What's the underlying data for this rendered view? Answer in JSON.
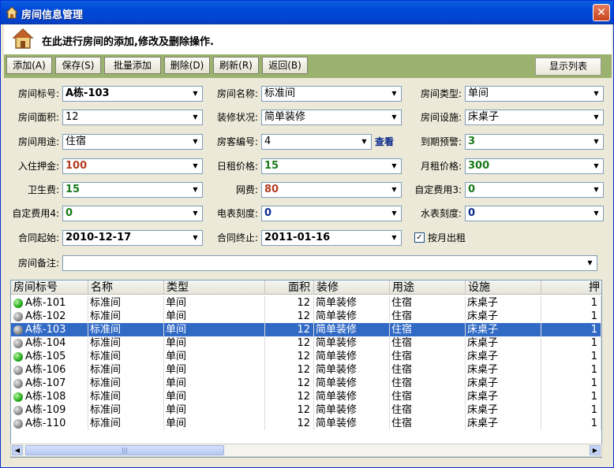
{
  "window": {
    "title": "房间信息管理",
    "close_label": "✕"
  },
  "header": {
    "text": "在此进行房间的添加,修改及删除操作."
  },
  "toolbar": {
    "buttons": [
      "添加(A)",
      "保存(S)",
      "批量添加",
      "删除(D)",
      "刷新(R)",
      "返回(B)"
    ],
    "show_list": "显示列表"
  },
  "form": {
    "room_no_label": "房间标号:",
    "room_no": "A栋-103",
    "room_name_label": "房间名称:",
    "room_name": "标准间",
    "room_type_label": "房间类型:",
    "room_type": "单间",
    "area_label": "房间面积:",
    "area": "12",
    "decor_label": "装修状况:",
    "decor": "简单装修",
    "facility_label": "房间设施:",
    "facility": "床桌子",
    "usage_label": "房间用途:",
    "usage": "住宿",
    "tenant_label": "房客编号:",
    "tenant": "4",
    "view_link": "查看",
    "expire_label": "到期预警:",
    "expire": "3",
    "deposit_label": "入住押金:",
    "deposit": "100",
    "daily_label": "日租价格:",
    "daily": "15",
    "monthly_label": "月租价格:",
    "monthly": "300",
    "sanitation_label": "卫生费:",
    "sanitation": "15",
    "network_label": "网费:",
    "network": "80",
    "custom3_label": "自定费用3:",
    "custom3": "0",
    "custom4_label": "自定费用4:",
    "custom4": "0",
    "elec_label": "电表刻度:",
    "elec": "0",
    "water_label": "水表刻度:",
    "water": "0",
    "start_label": "合同起始:",
    "start": "2010-12-17",
    "end_label": "合同终止:",
    "end": "2011-01-16",
    "monthly_rent_check": "按月出租",
    "note_label": "房间备注:",
    "note": ""
  },
  "grid": {
    "columns": [
      "房间标号",
      "名称",
      "类型",
      "面积",
      "装修",
      "用途",
      "设施",
      "押"
    ],
    "rows": [
      {
        "status": "green",
        "no": "A栋-101",
        "name": "标准间",
        "type": "单间",
        "area": "12",
        "decor": "简单装修",
        "usage": "住宿",
        "facility": "床桌子",
        "extra": "1"
      },
      {
        "status": "gray",
        "no": "A栋-102",
        "name": "标准间",
        "type": "单间",
        "area": "12",
        "decor": "简单装修",
        "usage": "住宿",
        "facility": "床桌子",
        "extra": "1"
      },
      {
        "status": "gray",
        "no": "A栋-103",
        "name": "标准间",
        "type": "单间",
        "area": "12",
        "decor": "简单装修",
        "usage": "住宿",
        "facility": "床桌子",
        "extra": "1"
      },
      {
        "status": "gray",
        "no": "A栋-104",
        "name": "标准间",
        "type": "单间",
        "area": "12",
        "decor": "简单装修",
        "usage": "住宿",
        "facility": "床桌子",
        "extra": "1"
      },
      {
        "status": "green",
        "no": "A栋-105",
        "name": "标准间",
        "type": "单间",
        "area": "12",
        "decor": "简单装修",
        "usage": "住宿",
        "facility": "床桌子",
        "extra": "1"
      },
      {
        "status": "gray",
        "no": "A栋-106",
        "name": "标准间",
        "type": "单间",
        "area": "12",
        "decor": "简单装修",
        "usage": "住宿",
        "facility": "床桌子",
        "extra": "1"
      },
      {
        "status": "gray",
        "no": "A栋-107",
        "name": "标准间",
        "type": "单间",
        "area": "12",
        "decor": "简单装修",
        "usage": "住宿",
        "facility": "床桌子",
        "extra": "1"
      },
      {
        "status": "green",
        "no": "A栋-108",
        "name": "标准间",
        "type": "单间",
        "area": "12",
        "decor": "简单装修",
        "usage": "住宿",
        "facility": "床桌子",
        "extra": "1"
      },
      {
        "status": "gray",
        "no": "A栋-109",
        "name": "标准间",
        "type": "单间",
        "area": "12",
        "decor": "简单装修",
        "usage": "住宿",
        "facility": "床桌子",
        "extra": "1"
      },
      {
        "status": "gray",
        "no": "A栋-110",
        "name": "标准间",
        "type": "单间",
        "area": "12",
        "decor": "简单装修",
        "usage": "住宿",
        "facility": "床桌子",
        "extra": "1"
      }
    ],
    "selected_row": 2
  },
  "colors": {
    "red_value": "#b53a1d",
    "green_value": "#1a7a1a",
    "blue_value": "#0b2a8a",
    "select": "#316ac5"
  }
}
